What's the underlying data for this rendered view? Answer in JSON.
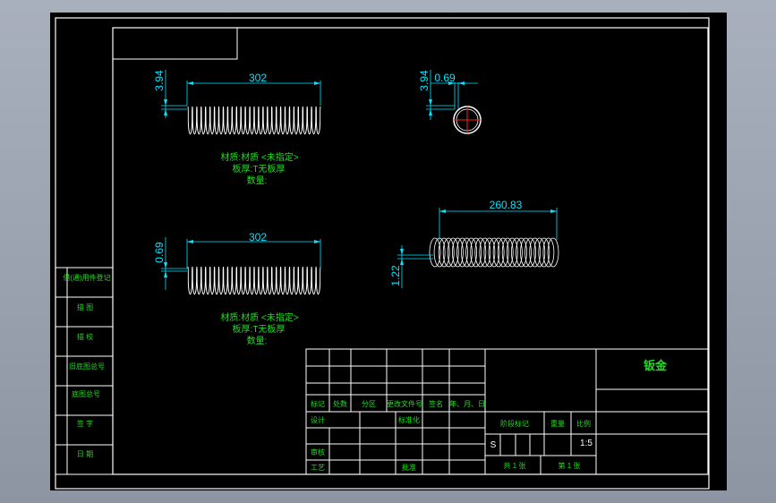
{
  "colors": {
    "background_outer": "#a2a9b6",
    "paper": "#000000",
    "frame": "#ffffff",
    "dimension": "#00e5ff",
    "text_green": "#22dd22",
    "part_outline": "#ffffff",
    "center_mark": "#ff2020"
  },
  "views": {
    "top_left": {
      "dim_length": "302",
      "dim_height": "3.94",
      "notes": [
        "材质:材质 <未指定>",
        "板厚:T无板厚",
        "数量:"
      ]
    },
    "bottom_left": {
      "dim_length": "302",
      "dim_height": "0.69",
      "notes": [
        "材质:材质 <未指定>",
        "板厚:T无板厚",
        "数量:"
      ]
    },
    "top_right": {
      "dim_height": "3.94",
      "dim_width": "0.69"
    },
    "bottom_right": {
      "dim_length": "260.83",
      "dim_height": "1.22"
    }
  },
  "left_strip": {
    "labels": [
      "借(通)用件登记",
      "描 图",
      "描 校",
      "旧底图总号",
      "底图总号",
      "签 字",
      "日 期"
    ]
  },
  "title_block": {
    "header_row": [
      "标记",
      "处数",
      "分区",
      "更改文件号",
      "签名",
      "年、月、日"
    ],
    "left_labels": [
      "设计",
      "审核",
      "工艺"
    ],
    "std_label": "标准化",
    "approve_label": "批准",
    "title": "钣金",
    "right_headers": [
      "阶段标记",
      "重量",
      "比例"
    ],
    "stage": "S",
    "scale": "1:5",
    "sheets_total": "共 1 张",
    "sheet_no": "第 1 张"
  }
}
